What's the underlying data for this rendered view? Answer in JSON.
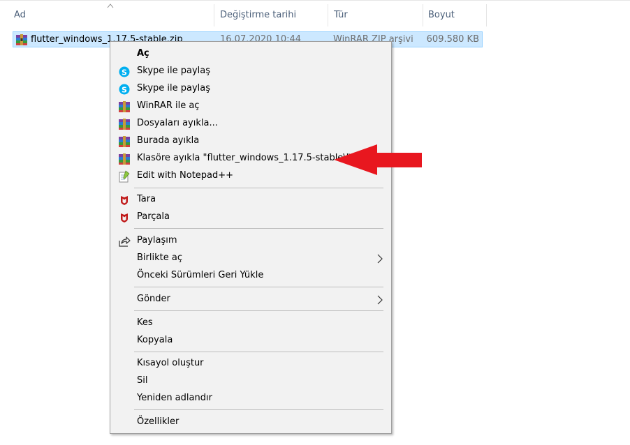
{
  "columns": {
    "name": "Ad",
    "date": "Değiştirme tarihi",
    "type": "Tür",
    "size": "Boyut"
  },
  "file": {
    "name": "flutter_windows_1.17.5-stable.zip",
    "date": "16.07.2020 10:44",
    "type": "WinRAR ZIP arşivi",
    "size": "609.580 KB",
    "icon": "winrar-archive-icon"
  },
  "menu": {
    "open": "Aç",
    "skype_share_1": "Skype ile paylaş",
    "skype_share_2": "Skype ile paylaş",
    "winrar_open": "WinRAR ile aç",
    "extract_files": "Dosyaları ayıkla...",
    "extract_here": "Burada ayıkla",
    "extract_to_folder": "Klasöre ayıkla \"flutter_windows_1.17.5-stable\\\"",
    "edit_notepadpp": "Edit with Notepad++",
    "scan": "Tara",
    "shred": "Parçala",
    "share": "Paylaşım",
    "open_with": "Birlikte aç",
    "restore_versions": "Önceki Sürümleri Geri Yükle",
    "send_to": "Gönder",
    "cut": "Kes",
    "copy": "Kopyala",
    "create_shortcut": "Kısayol oluştur",
    "delete": "Sil",
    "rename": "Yeniden adlandır",
    "properties": "Özellikler"
  },
  "colors": {
    "selection_bg": "#cce8ff",
    "menu_bg": "#f2f2f2",
    "header_text": "#4c607a",
    "skype_blue": "#00aff0",
    "mcafee_red": "#c01818",
    "arrow_red": "#e8171f"
  }
}
